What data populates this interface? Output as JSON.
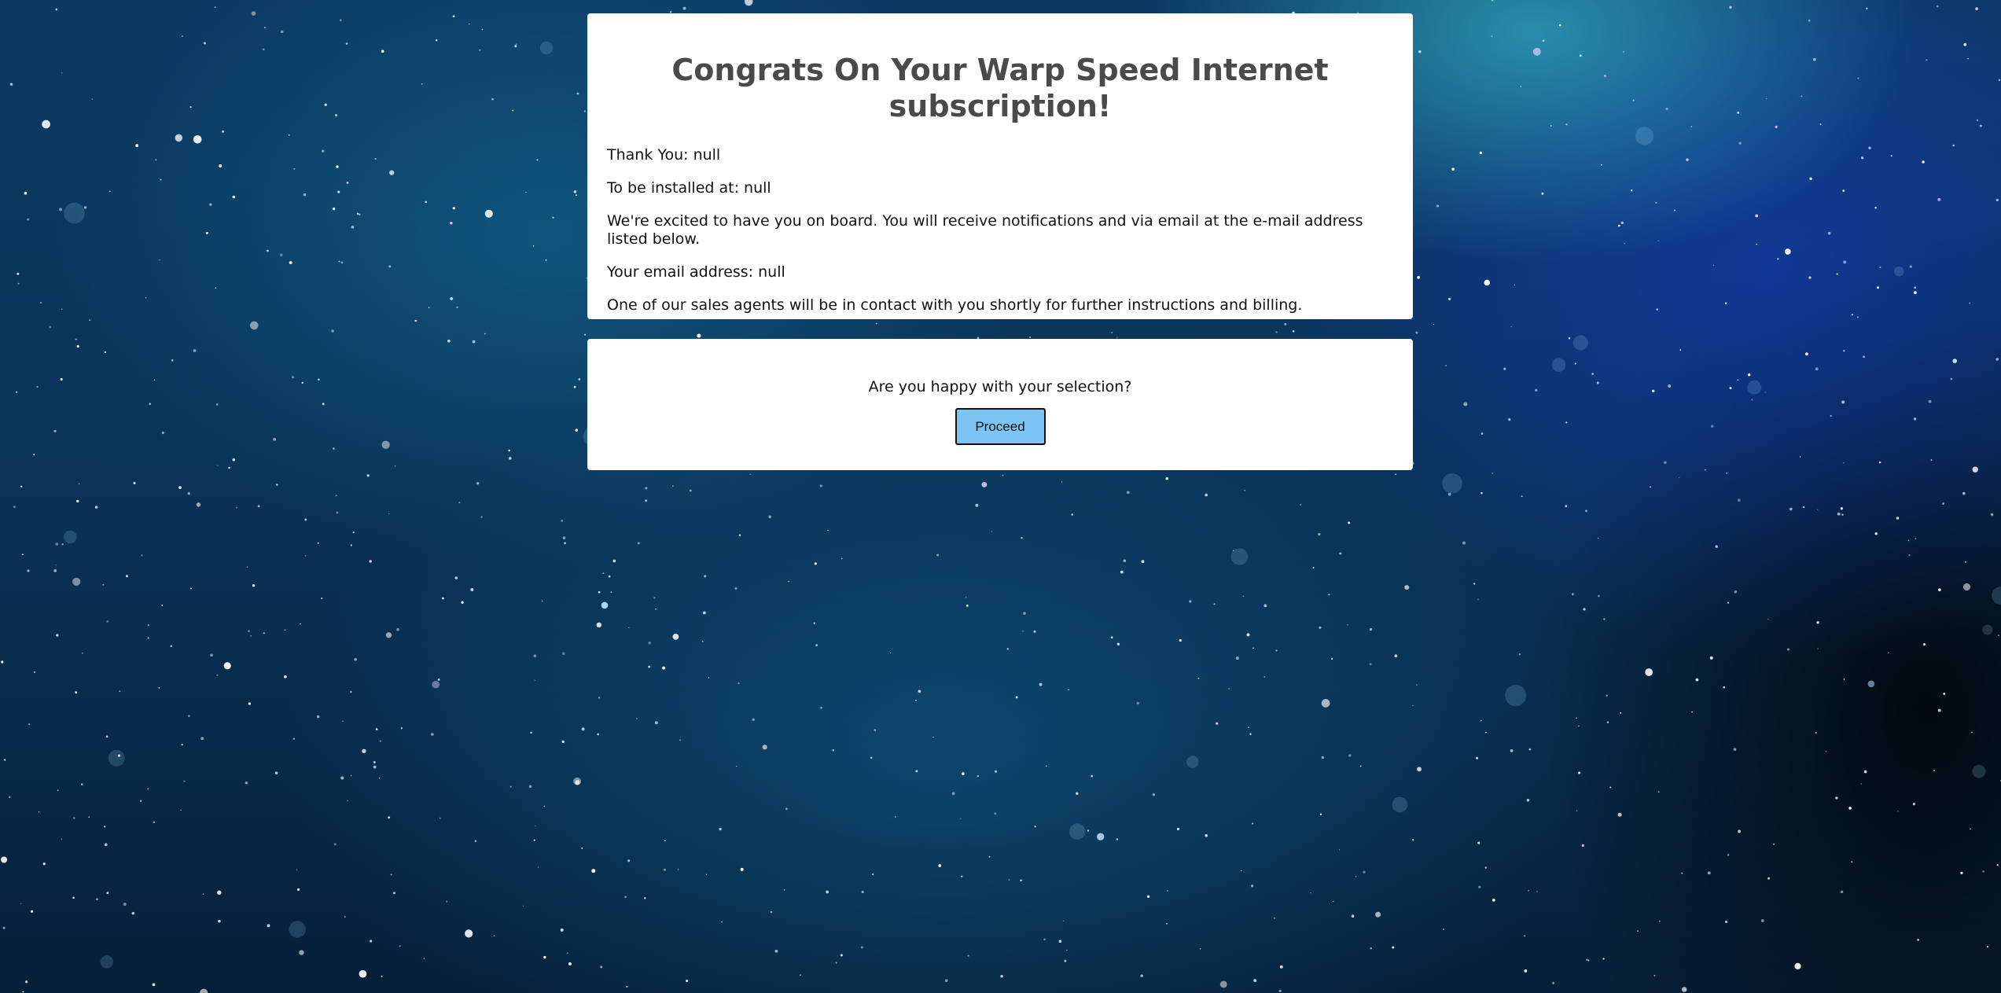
{
  "theme": {
    "card_background": "#ffffff",
    "title_color": "#4a4a4a",
    "button_color": "#7cc4f4",
    "background": "space-starfield"
  },
  "main_card": {
    "title": "Congrats On Your Warp Speed Internet subscription!",
    "thank_you": "Thank You: null",
    "install_address": "To be installed at: null",
    "welcome_message": "We're excited to have you on board. You will receive notifications and via email at the e-mail address listed below.",
    "email_address": "Your email address: null",
    "sales_message": "One of our sales agents will be in contact with you shortly for further instructions and billing."
  },
  "confirm_card": {
    "question": "Are you happy with your selection?",
    "proceed_label": "Proceed"
  }
}
